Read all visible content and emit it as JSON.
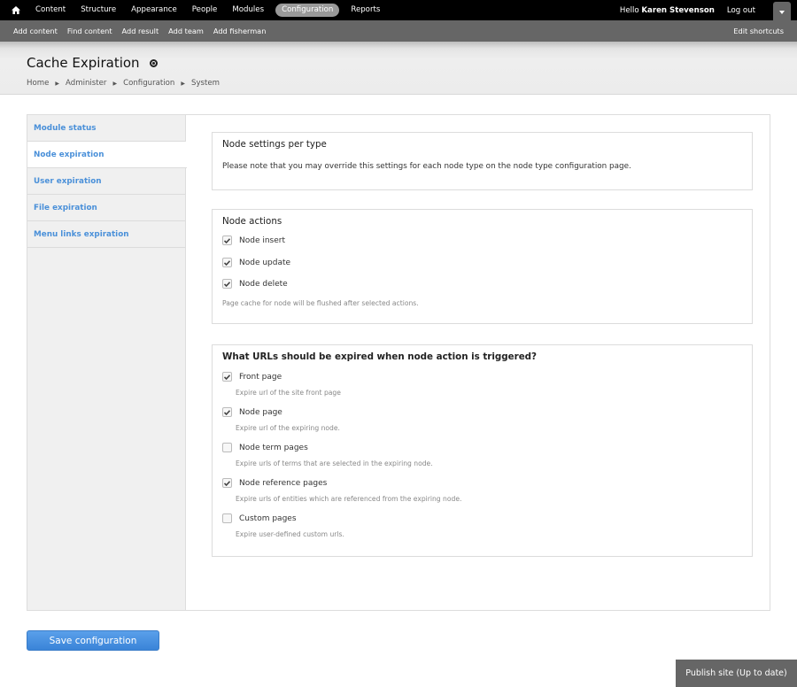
{
  "toolbar": {
    "home_icon": "home-icon",
    "menu": [
      {
        "label": "Content",
        "active": false
      },
      {
        "label": "Structure",
        "active": false
      },
      {
        "label": "Appearance",
        "active": false
      },
      {
        "label": "People",
        "active": false
      },
      {
        "label": "Modules",
        "active": false
      },
      {
        "label": "Configuration",
        "active": true
      },
      {
        "label": "Reports",
        "active": false
      }
    ],
    "greeting_prefix": "Hello ",
    "user_name": "Karen Stevenson",
    "logout_label": "Log out",
    "toggle_icon": "caret-down-icon"
  },
  "shortcuts": {
    "items": [
      "Add content",
      "Find content",
      "Add result",
      "Add team",
      "Add fisherman"
    ],
    "edit_label": "Edit shortcuts"
  },
  "header": {
    "title": "Cache Expiration",
    "shortcut_icon": "add-shortcut-icon",
    "breadcrumb": [
      "Home",
      "Administer",
      "Configuration",
      "System"
    ]
  },
  "vertical_tabs": {
    "items": [
      {
        "label": "Module status",
        "active": false
      },
      {
        "label": "Node expiration",
        "active": true
      },
      {
        "label": "User expiration",
        "active": false
      },
      {
        "label": "File expiration",
        "active": false
      },
      {
        "label": "Menu links expiration",
        "active": false
      }
    ]
  },
  "node_settings": {
    "legend": "Node settings per type",
    "description": "Please note that you may override this settings for each node type on the node type configuration page."
  },
  "node_actions": {
    "legend": "Node actions",
    "options": [
      {
        "label": "Node insert",
        "checked": true
      },
      {
        "label": "Node update",
        "checked": true
      },
      {
        "label": "Node delete",
        "checked": true
      }
    ],
    "description": "Page cache for node will be flushed after selected actions."
  },
  "expire_urls": {
    "legend": "What URLs should be expired when node action is triggered?",
    "options": [
      {
        "label": "Front page",
        "checked": true,
        "description": "Expire url of the site front page"
      },
      {
        "label": "Node page",
        "checked": true,
        "description": "Expire url of the expiring node."
      },
      {
        "label": "Node term pages",
        "checked": false,
        "description": "Expire urls of terms that are selected in the expiring node."
      },
      {
        "label": "Node reference pages",
        "checked": true,
        "description": "Expire urls of entities which are referenced from the expiring node."
      },
      {
        "label": "Custom pages",
        "checked": false,
        "description": "Expire user-defined custom urls."
      }
    ]
  },
  "actions": {
    "save_label": "Save configuration"
  },
  "publish": {
    "label": "Publish site (Up to date)"
  },
  "colors": {
    "link_blue": "#4a90d9",
    "button_blue": "#3a84d8",
    "toolbar_black": "#000000",
    "shortcut_gray": "#666666"
  }
}
